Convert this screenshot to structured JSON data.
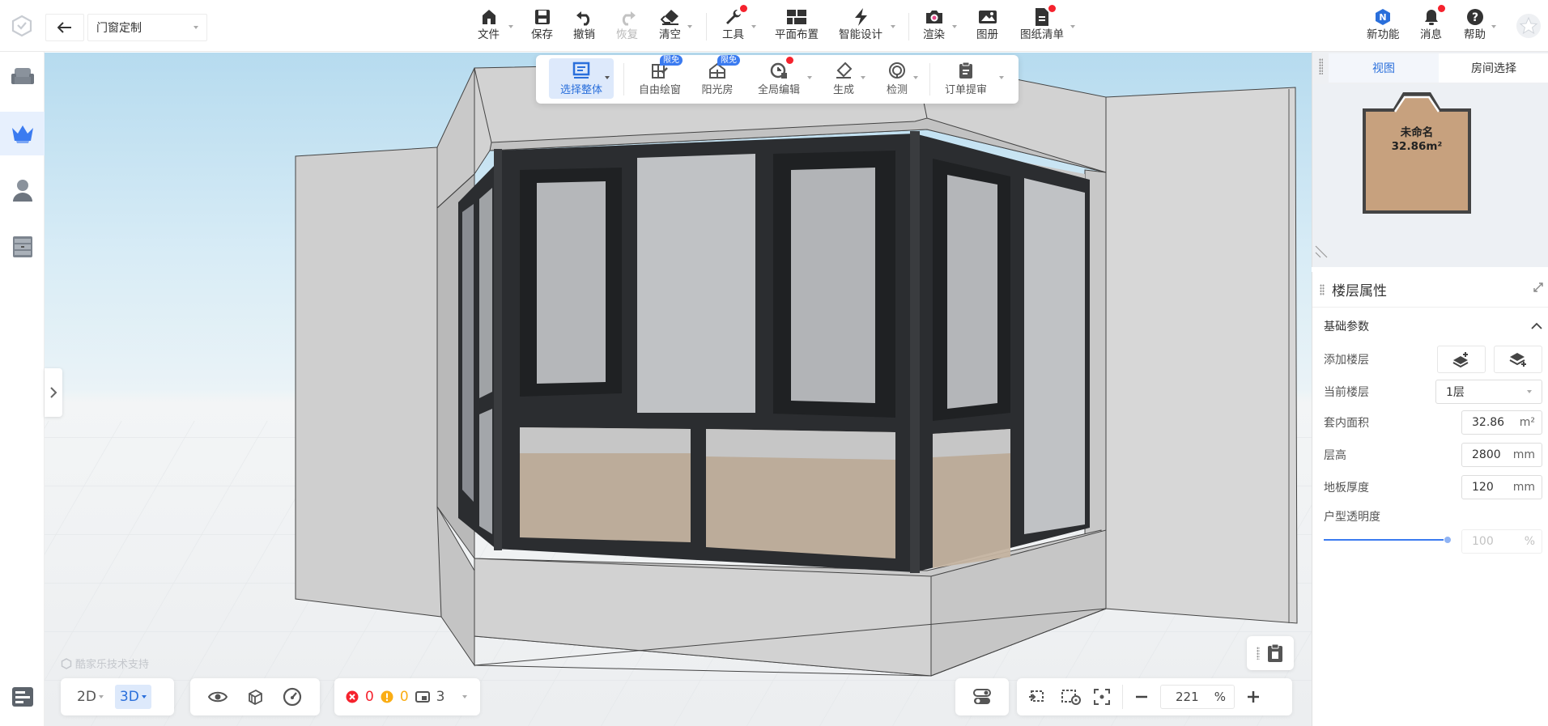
{
  "header": {
    "module_select": "门窗定制",
    "tools": [
      {
        "label": "文件",
        "icon": "file-icon"
      },
      {
        "label": "保存",
        "icon": "save-icon"
      },
      {
        "label": "撤销",
        "icon": "undo-icon"
      },
      {
        "label": "恢复",
        "icon": "redo-icon",
        "disabled": true
      },
      {
        "label": "清空",
        "icon": "eraser-icon"
      },
      {
        "label": "工具",
        "icon": "wrench-icon",
        "dot": true
      },
      {
        "label": "平面布置",
        "icon": "layout-icon"
      },
      {
        "label": "智能设计",
        "icon": "lightning-icon"
      },
      {
        "label": "渲染",
        "icon": "camera-icon"
      },
      {
        "label": "图册",
        "icon": "album-icon"
      },
      {
        "label": "图纸清单",
        "icon": "drawing-list-icon",
        "dot": true
      }
    ],
    "right_tools": [
      {
        "label": "新功能",
        "icon": "new-feature-icon"
      },
      {
        "label": "消息",
        "icon": "bell-icon",
        "dot": true
      },
      {
        "label": "帮助",
        "icon": "help-icon"
      }
    ]
  },
  "left_rail": {
    "items": [
      {
        "name": "furniture",
        "icon": "sofa-icon"
      },
      {
        "name": "crown",
        "icon": "crown-icon",
        "active": true
      },
      {
        "name": "user",
        "icon": "user-icon"
      },
      {
        "name": "cabinet",
        "icon": "cabinet-icon"
      }
    ]
  },
  "float_toolbar": {
    "items": [
      {
        "label": "选择整体",
        "icon": "select-all-icon",
        "active": true
      },
      {
        "label": "自由绘窗",
        "icon": "draw-window-icon",
        "badge": "限免"
      },
      {
        "label": "阳光房",
        "icon": "sunroom-icon",
        "badge": "限免"
      },
      {
        "label": "全局编辑",
        "icon": "global-edit-icon",
        "dot": true
      },
      {
        "label": "生成",
        "icon": "generate-icon"
      },
      {
        "label": "检测",
        "icon": "detect-icon"
      },
      {
        "label": "订单提审",
        "icon": "order-icon"
      }
    ]
  },
  "watermark": "酷家乐技术支持",
  "bottom": {
    "mode_2d": "2D",
    "mode_3d": "3D",
    "errors": "0",
    "warnings": "0",
    "layers": "3",
    "zoom": "221",
    "zoom_unit": "%"
  },
  "right_panel": {
    "tabs": [
      "视图",
      "房间选择"
    ],
    "minimap": {
      "room_name": "未命名",
      "room_area": "32.86m²"
    },
    "title": "楼层属性",
    "section": "基础参数",
    "add_floor_label": "添加楼层",
    "current_floor_label": "当前楼层",
    "current_floor_value": "1层",
    "inner_area_label": "套内面积",
    "inner_area_value": "32.86",
    "inner_area_unit": "m²",
    "height_label": "层高",
    "height_value": "2800",
    "height_unit": "mm",
    "floor_thickness_label": "地板厚度",
    "floor_thickness_value": "120",
    "floor_thickness_unit": "mm",
    "transparency_label": "户型透明度",
    "transparency_value": "100",
    "transparency_unit": "%",
    "transparency_level": 1.0
  },
  "colors": {
    "accent": "#2a6fdb",
    "frame": "#2b2d30",
    "wall": "#d9d9d9",
    "floor": "#c2a386"
  }
}
